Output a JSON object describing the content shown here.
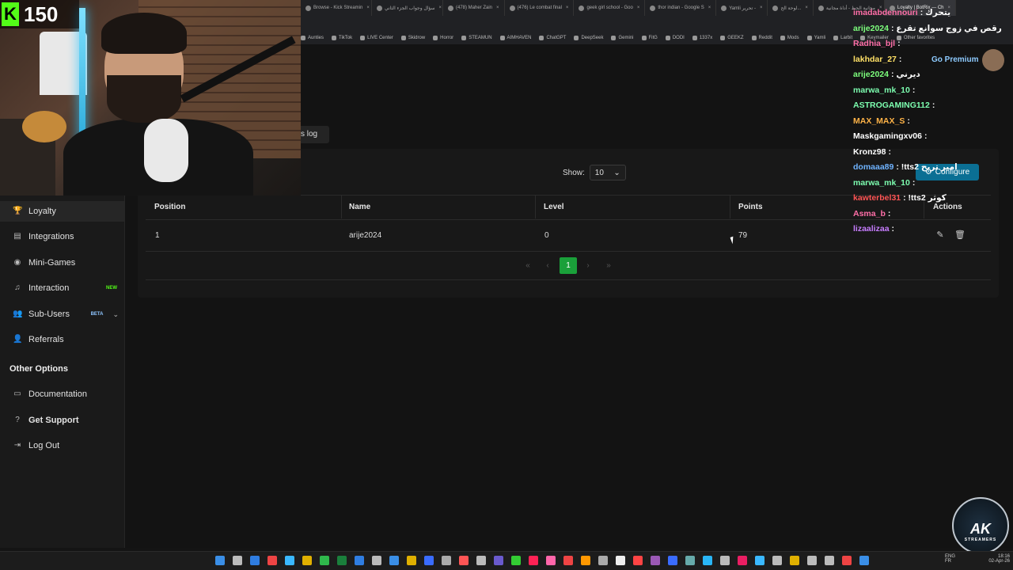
{
  "browser": {
    "tabs": [
      {
        "label": "Browse - Kick Streamin"
      },
      {
        "label": "سؤال وجواب الجزء الثاني"
      },
      {
        "label": "(478) Maher Zain"
      },
      {
        "label": "(476) Le combat final"
      },
      {
        "label": "geek girl school - Goo"
      },
      {
        "label": "thor indian - Google S"
      },
      {
        "label": "Yamli تحرير -"
      },
      {
        "label": "لوحة الح..."
      },
      {
        "label": "مجانية الحظ - أداة مجانية"
      },
      {
        "label": "Loyalty | BotRix — Ch"
      }
    ],
    "bookmarks": [
      "Aunties",
      "TikTok",
      "LIVE Center",
      "Skidrow",
      "Horror",
      "STEAMUN",
      "AIMHAVEN",
      "ChatGPT",
      "DeepSeek",
      "Gemini",
      "FitG",
      "DODI",
      "1337x",
      "GEEKZ",
      "Reddit",
      "Mods",
      "Yamli",
      "Larbit",
      "Keymailer",
      "Other favorites"
    ]
  },
  "stream": {
    "platform_letter": "K",
    "viewer_count": "150"
  },
  "sidebar": {
    "items": [
      {
        "label": "Loyalty",
        "icon": "trophy-icon",
        "badge": ""
      },
      {
        "label": "Integrations",
        "icon": "integrations-icon",
        "badge": ""
      },
      {
        "label": "Mini-Games",
        "icon": "gamepad-icon",
        "badge": ""
      },
      {
        "label": "Interaction",
        "icon": "music-icon",
        "badge": "NEW"
      },
      {
        "label": "Sub-Users",
        "icon": "users-icon",
        "badge": "BETA"
      },
      {
        "label": "Referrals",
        "icon": "referrals-icon",
        "badge": ""
      }
    ],
    "other_heading": "Other Options",
    "other_items": [
      {
        "label": "Documentation",
        "icon": "document-icon"
      },
      {
        "label": "Get Support",
        "icon": "question-icon"
      },
      {
        "label": "Log Out",
        "icon": "logout-icon"
      }
    ]
  },
  "page": {
    "tab_label": "s log",
    "show_label": "Show:",
    "show_value": "10",
    "configure_label": "Configure",
    "table": {
      "headers": [
        "Position",
        "Name",
        "Level",
        "Points",
        "Actions"
      ],
      "rows": [
        {
          "position": "1",
          "name": "arije2024",
          "level": "0",
          "points": "79"
        }
      ]
    },
    "pagination": {
      "first": "«",
      "prev": "‹",
      "current": "1",
      "next": "›",
      "last": "»"
    }
  },
  "chat": {
    "messages": [
      {
        "user": "imadabdennouri",
        "text": ": يتحرك",
        "color": "#ff6fa8"
      },
      {
        "user": "arije2024",
        "text": ": رقص في زوج سوانع تقرع",
        "color": "#7dff7d"
      },
      {
        "user": "Radhia_bjl",
        "text": ":",
        "color": "#ff6fa8"
      },
      {
        "user": "lakhdar_27",
        "text": ":",
        "color": "#ffe066"
      },
      {
        "user": "arije2024",
        "text": ": ديرني",
        "color": "#7dff7d"
      },
      {
        "user": "marwa_mk_10",
        "text": ":",
        "color": "#7dffb0"
      },
      {
        "user": "ASTROGAMING112",
        "text": ":",
        "color": "#7dffb0"
      },
      {
        "user": "MAX_MAX_S",
        "text": ":",
        "color": "#ffb347"
      },
      {
        "user": "Maskgamingxv06",
        "text": ":",
        "color": "#ffffff"
      },
      {
        "user": "Kronz98",
        "text": ":",
        "color": "#ffffff"
      },
      {
        "user": "domaaa89",
        "text": ": !tts2 امير تربح",
        "color": "#6fb3ff"
      },
      {
        "user": "marwa_mk_10",
        "text": ":",
        "color": "#7dffb0"
      },
      {
        "user": "kawterbel31",
        "text": ": !tts2 كوثر",
        "color": "#ff5555"
      },
      {
        "user": "Asma_b",
        "text": ":",
        "color": "#ff6fa8"
      },
      {
        "user": "lizaalizaa",
        "text": ":",
        "color": "#c77dff"
      }
    ],
    "go_premium": "Go Premium"
  },
  "tray": {
    "lang": "ENG",
    "region": "FR",
    "time": "18:16",
    "date": "02-Apr-26"
  },
  "overlay_logo": {
    "line1": "AK",
    "line2": "STREAMERS"
  }
}
